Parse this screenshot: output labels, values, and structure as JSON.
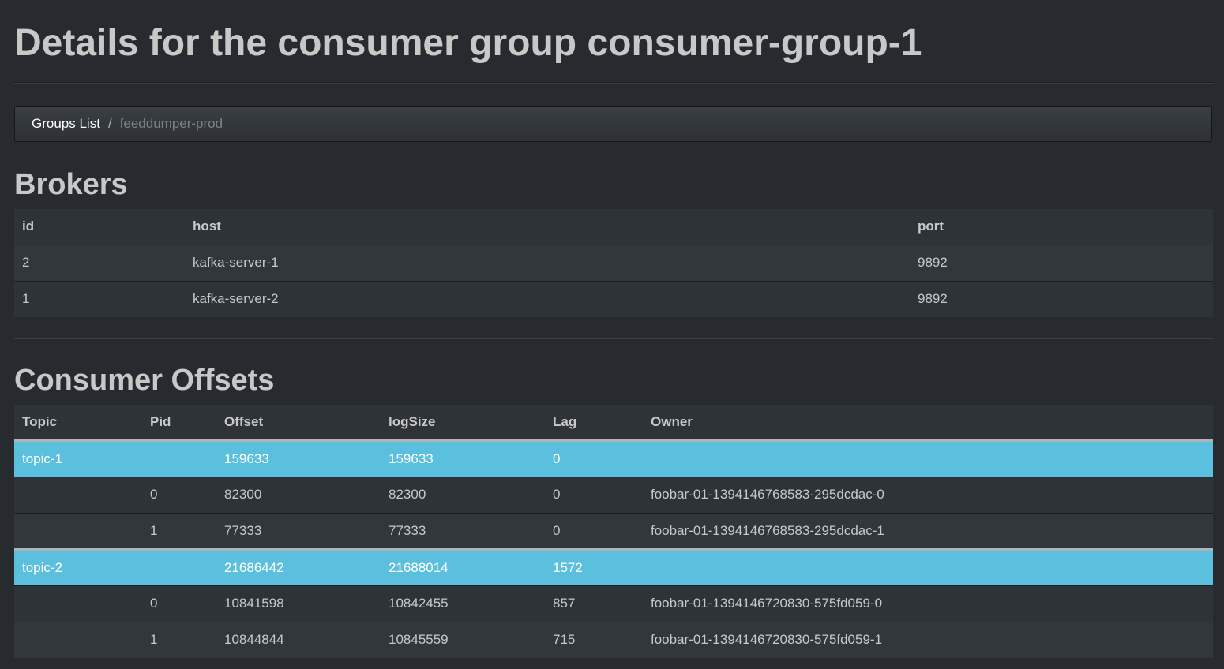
{
  "page": {
    "title": "Details for the consumer group consumer-group-1"
  },
  "breadcrumb": {
    "link_label": "Groups List",
    "separator": "/",
    "active_label": "feeddumper-prod"
  },
  "brokers": {
    "heading": "Brokers",
    "columns": [
      "id",
      "host",
      "port"
    ],
    "rows": [
      {
        "id": "2",
        "host": "kafka-server-1",
        "port": "9892"
      },
      {
        "id": "1",
        "host": "kafka-server-2",
        "port": "9892"
      }
    ]
  },
  "offsets": {
    "heading": "Consumer Offsets",
    "columns": [
      "Topic",
      "Pid",
      "Offset",
      "logSize",
      "Lag",
      "Owner"
    ],
    "topics": [
      {
        "topic": "topic-1",
        "offset": "159633",
        "logSize": "159633",
        "lag": "0",
        "partitions": [
          {
            "pid": "0",
            "offset": "82300",
            "logSize": "82300",
            "lag": "0",
            "owner": "foobar-01-1394146768583-295dcdac-0"
          },
          {
            "pid": "1",
            "offset": "77333",
            "logSize": "77333",
            "lag": "0",
            "owner": "foobar-01-1394146768583-295dcdac-1"
          }
        ]
      },
      {
        "topic": "topic-2",
        "offset": "21686442",
        "logSize": "21688014",
        "lag": "1572",
        "partitions": [
          {
            "pid": "0",
            "offset": "10841598",
            "logSize": "10842455",
            "lag": "857",
            "owner": "foobar-01-1394146720830-575fd059-0"
          },
          {
            "pid": "1",
            "offset": "10844844",
            "logSize": "10845559",
            "lag": "715",
            "owner": "foobar-01-1394146720830-575fd059-1"
          }
        ]
      }
    ]
  },
  "colors": {
    "background": "#272b30",
    "highlight_row": "#5bc0de",
    "text": "#c8c8c8"
  }
}
